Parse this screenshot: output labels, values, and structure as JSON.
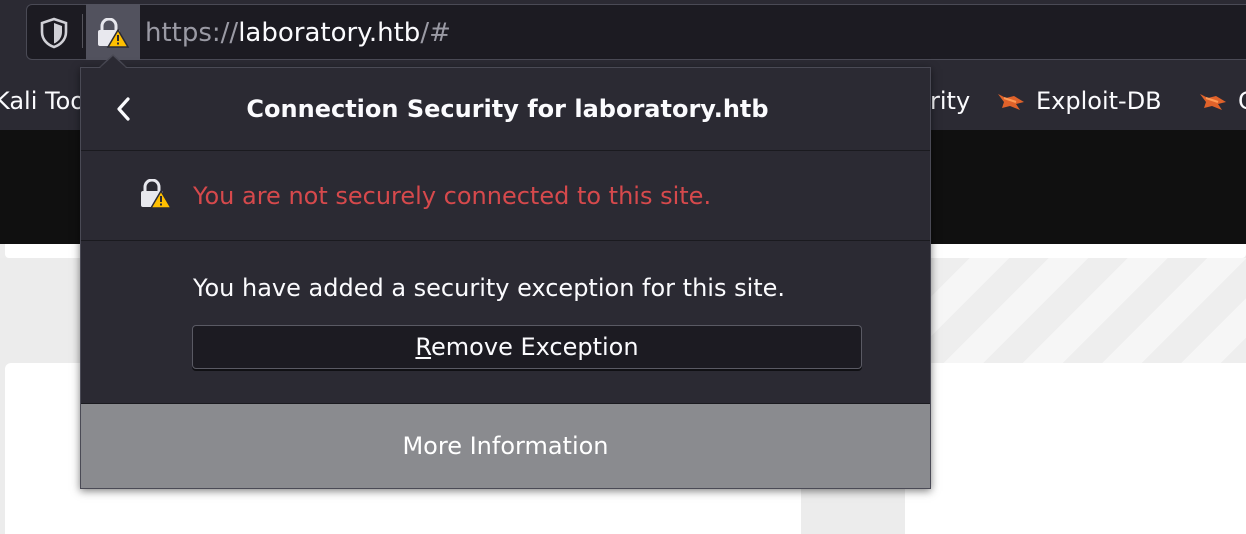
{
  "urlbar": {
    "scheme": "https://",
    "host": "laboratory.htb",
    "rest": "/#",
    "shield_icon": "tracking-protection-shield-icon",
    "lock_icon": "insecure-lock-warning-icon"
  },
  "bookmarks": {
    "items": [
      {
        "label": "Kali Too",
        "icon": "none"
      },
      {
        "label": "rity",
        "icon": "none"
      },
      {
        "label": "Exploit-DB",
        "icon": "exploitdb-bug-icon"
      },
      {
        "label": "G",
        "icon": "exploitdb-bug-icon"
      }
    ]
  },
  "popup": {
    "title": "Connection Security for laboratory.htb",
    "back_icon": "chevron-left-icon",
    "insecure_message": "You are not securely connected to this site.",
    "exception_message": "You have added a security exception for this site.",
    "remove_button": {
      "mnemonic": "R",
      "rest": "emove Exception"
    },
    "more_info_button": "More Information"
  },
  "colors": {
    "panel_bg": "#2b2a33",
    "warning_red": "#d6494c",
    "more_info_bg": "#8a8b8f",
    "warning_yellow": "#ffbf00"
  }
}
